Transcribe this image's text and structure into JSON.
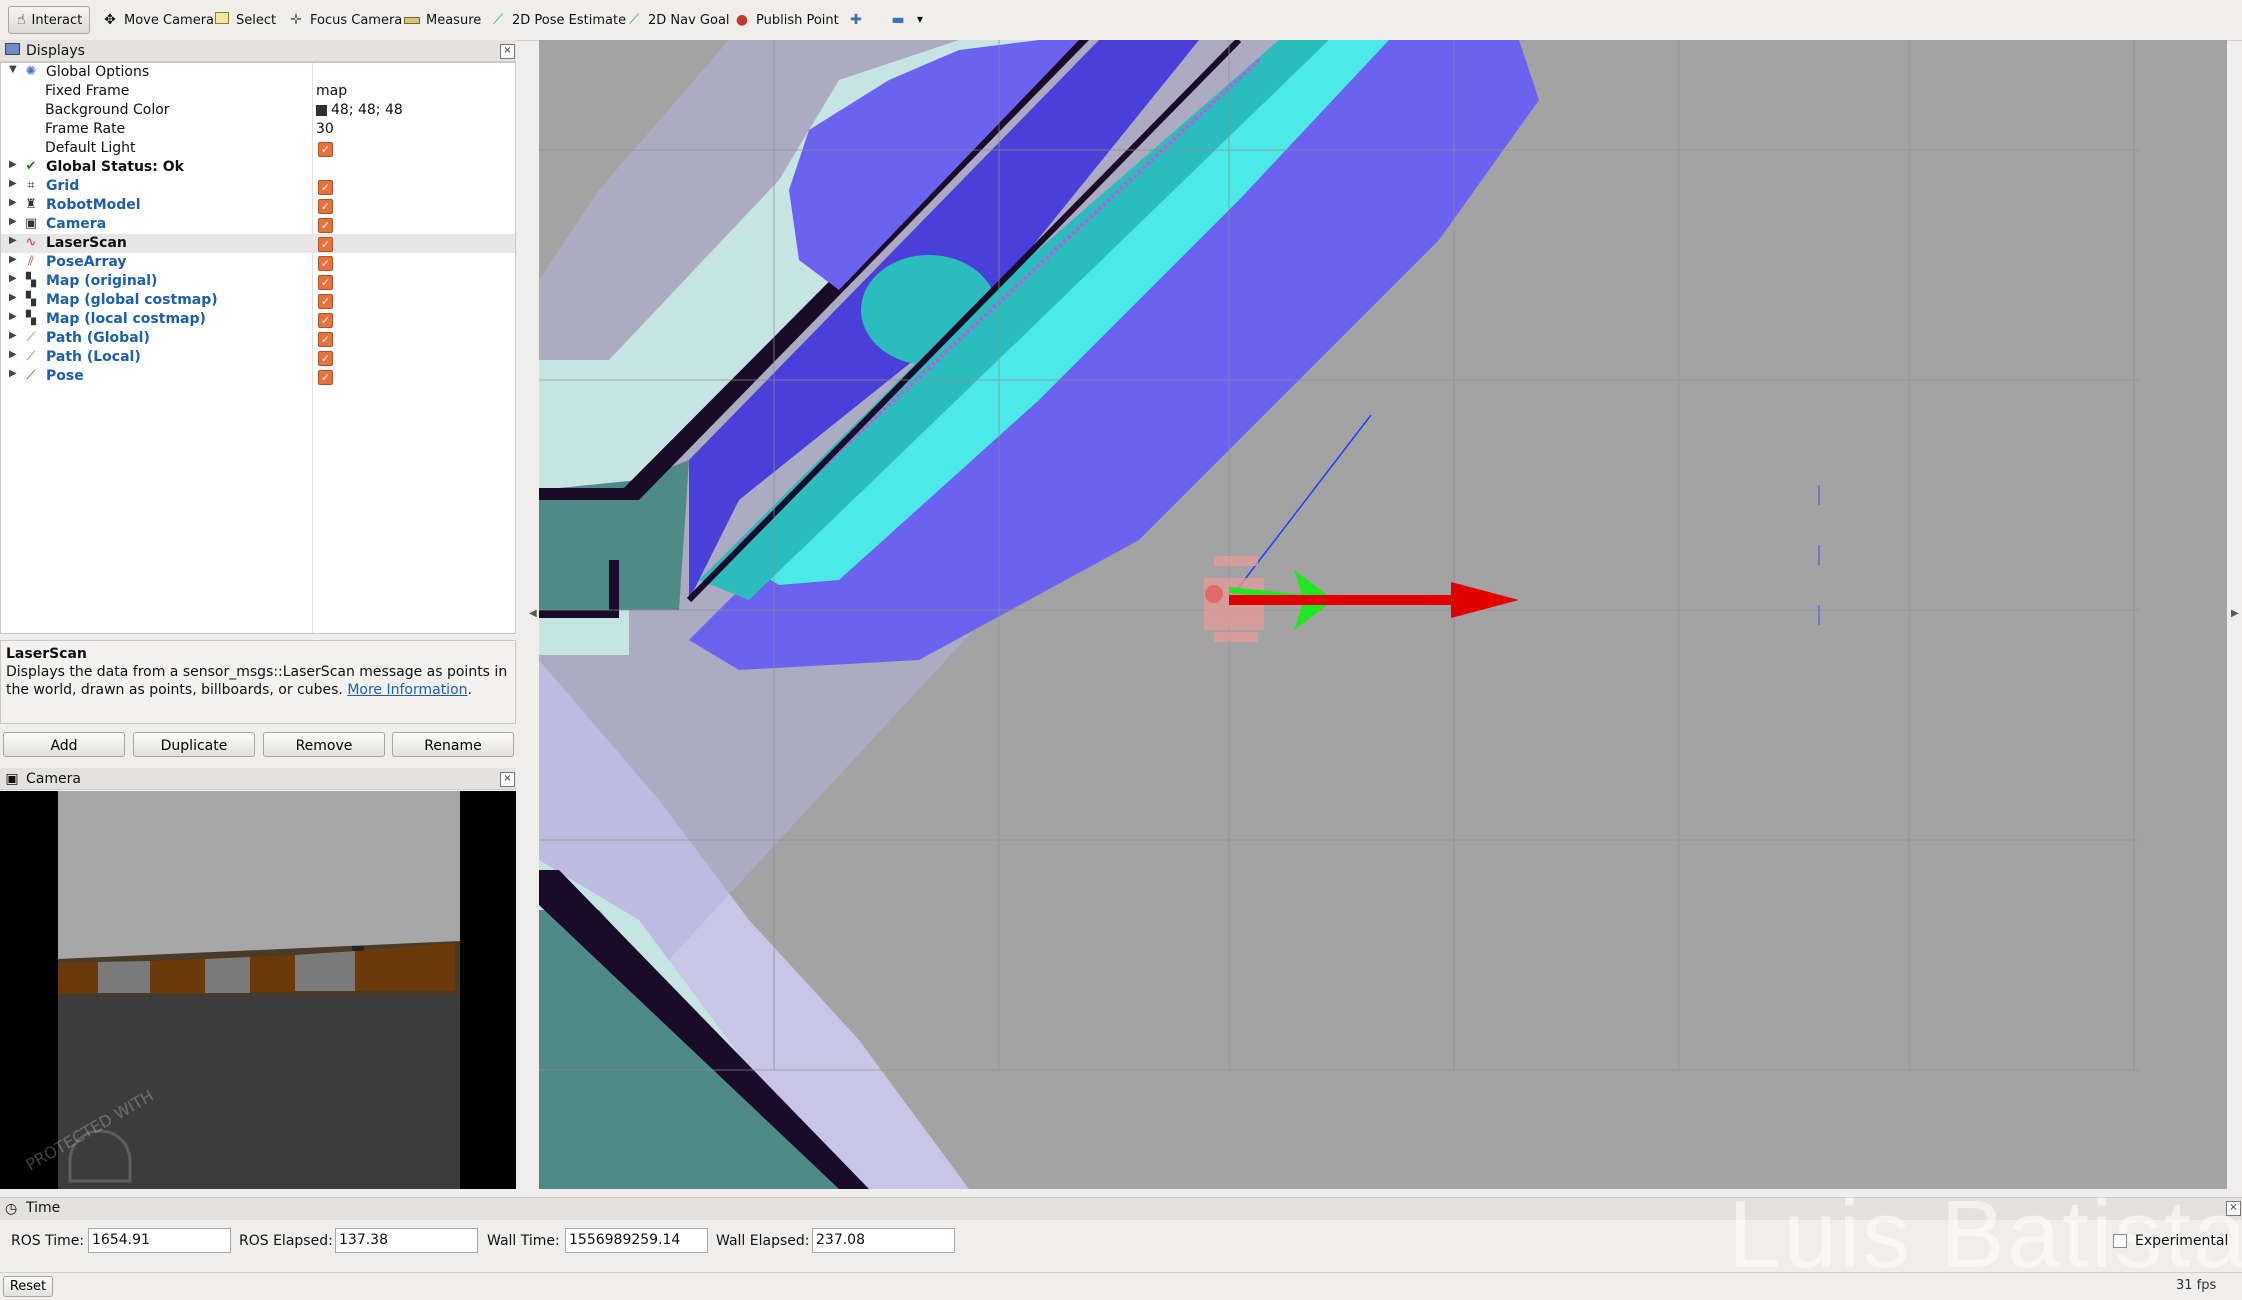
{
  "toolbar": {
    "interact": "Interact",
    "move_camera": "Move Camera",
    "select": "Select",
    "focus_camera": "Focus Camera",
    "measure": "Measure",
    "pose_estimate": "2D Pose Estimate",
    "nav_goal": "2D Nav Goal",
    "publish_point": "Publish Point"
  },
  "displays_panel": {
    "title": "Displays",
    "value_column": "",
    "rows": [
      {
        "label": "Global Options",
        "value": ""
      },
      {
        "label": "Fixed Frame",
        "value": "map"
      },
      {
        "label": "Background Color",
        "value": "48; 48; 48"
      },
      {
        "label": "Frame Rate",
        "value": "30"
      },
      {
        "label": "Default Light",
        "value": ""
      },
      {
        "label": "Global Status: Ok",
        "value": ""
      },
      {
        "label": "Grid",
        "value": ""
      },
      {
        "label": "RobotModel",
        "value": ""
      },
      {
        "label": "Camera",
        "value": ""
      },
      {
        "label": "LaserScan",
        "value": ""
      },
      {
        "label": "PoseArray",
        "value": ""
      },
      {
        "label": "Map (original)",
        "value": ""
      },
      {
        "label": "Map (global costmap)",
        "value": ""
      },
      {
        "label": "Map (local costmap)",
        "value": ""
      },
      {
        "label": "Path (Global)",
        "value": ""
      },
      {
        "label": "Path (Local)",
        "value": ""
      },
      {
        "label": "Pose",
        "value": ""
      }
    ]
  },
  "description": {
    "title": "LaserScan",
    "text": "Displays the data from a sensor_msgs::LaserScan message as points in the world, drawn as points, billboards, or cubes.",
    "link": "More Information",
    "period": "."
  },
  "buttons": {
    "add": "Add",
    "duplicate": "Duplicate",
    "remove": "Remove",
    "rename": "Rename"
  },
  "camera_panel": {
    "title": "Camera",
    "watermark": "PROTECTED WITH"
  },
  "time_panel": {
    "title": "Time",
    "ros_time_label": "ROS Time:",
    "ros_time": "1654.91",
    "ros_elapsed_label": "ROS Elapsed:",
    "ros_elapsed": "137.38",
    "wall_time_label": "Wall Time:",
    "wall_time": "1556989259.14",
    "wall_elapsed_label": "Wall Elapsed:",
    "wall_elapsed": "237.08",
    "experimental": "Experimental"
  },
  "status": {
    "reset": "Reset",
    "fps": "31 fps"
  },
  "overlay_watermark": "Luis Batista",
  "colors": {
    "view_background": "#a3a3a3",
    "costmap_inflation": "#6b62f0",
    "costmap_core": "#4de8e8",
    "map_obstacle": "#1a0b2a",
    "pose_arrow": "#e00000",
    "path": "#00e000",
    "checkbox": "#e8733a"
  }
}
